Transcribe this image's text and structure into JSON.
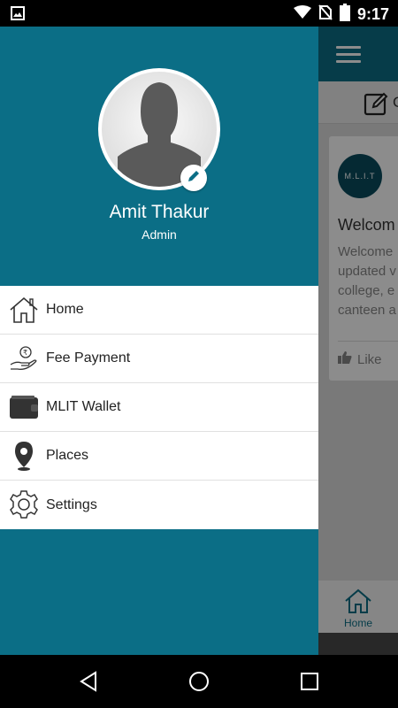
{
  "status_bar": {
    "time": "9:17",
    "icons": [
      "image-icon",
      "wifi-icon",
      "no-sim-icon",
      "battery-icon"
    ]
  },
  "drawer": {
    "user": {
      "name": "Amit Thakur",
      "role": "Admin"
    },
    "menu": [
      {
        "label": "Home",
        "icon": "home-icon"
      },
      {
        "label": "Fee Payment",
        "icon": "fee-payment-icon"
      },
      {
        "label": "MLIT Wallet",
        "icon": "wallet-icon"
      },
      {
        "label": "Places",
        "icon": "location-pin-icon"
      },
      {
        "label": "Settings",
        "icon": "gear-icon"
      }
    ],
    "colors": {
      "header": "#0b6e86",
      "menu_bg": "#ffffff"
    }
  },
  "background_app": {
    "subbar_text": "C",
    "card": {
      "logo_text": "M.L.I.T",
      "title": "Welcom",
      "body_lines": [
        "Welcome",
        "updated v",
        "college, e",
        "canteen a"
      ],
      "like_label": "Like"
    },
    "bottom_nav": {
      "home_label": "Home"
    }
  }
}
